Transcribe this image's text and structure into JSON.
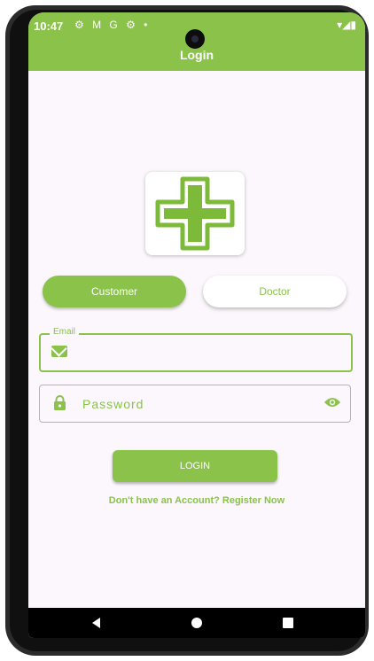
{
  "status_bar": {
    "time": "10:47",
    "left_icons": "⚙ M G ⚙ •",
    "right_icons": "▾◢▮"
  },
  "app_bar": {
    "title": "Login"
  },
  "logo": {
    "icon": "medical-cross-icon",
    "color": "#7dba3a"
  },
  "role_toggle": {
    "customer_label": "Customer",
    "doctor_label": "Doctor",
    "selected": "Customer"
  },
  "email": {
    "label": "Email",
    "value": "",
    "icon": "mail-icon"
  },
  "password": {
    "placeholder": "Password",
    "value": "",
    "icon": "lock-icon",
    "toggle_icon": "eye-icon"
  },
  "login_button": {
    "label": "LOGIN"
  },
  "register": {
    "prompt": "Don't have an Account?",
    "link": "Register Now"
  },
  "colors": {
    "accent": "#8ac24a",
    "background": "#fbf7fc",
    "navbar": "#000000"
  },
  "nav_bar": {
    "back": "back-icon",
    "home": "home-icon",
    "recents": "recents-icon"
  }
}
